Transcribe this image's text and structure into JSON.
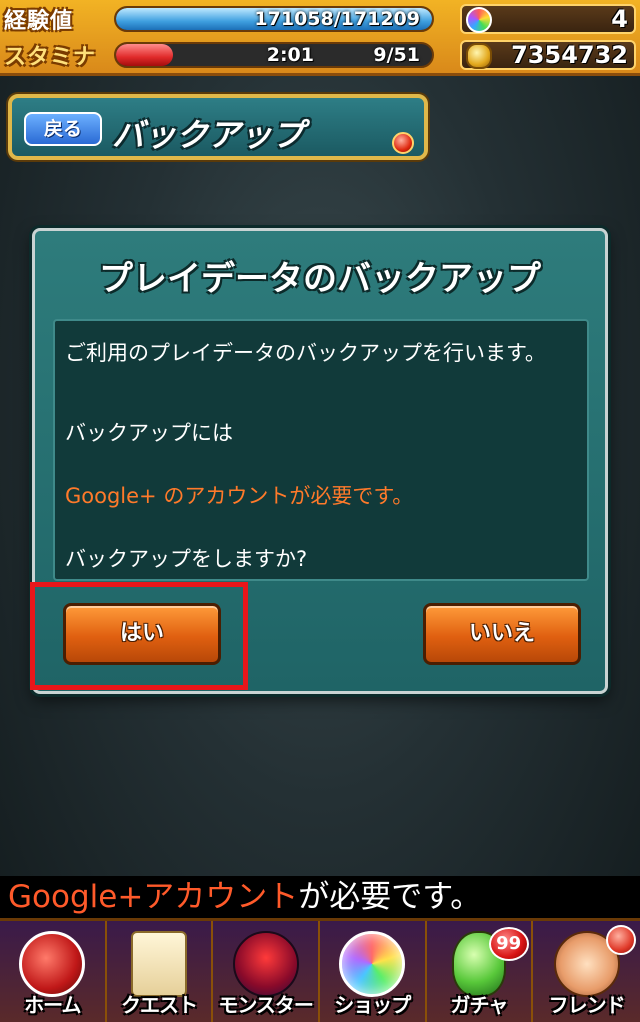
{
  "status": {
    "exp_label": "経験値",
    "exp_value": "171058/171209",
    "exp_progress": 0.999,
    "stamina_label": "スタミナ",
    "stamina_timer": "2:01",
    "stamina_value": "9/51",
    "stamina_progress": 0.18,
    "orbs": "4",
    "coins": "7354732",
    "orb_icon": "rainbow-orb-icon",
    "coin_icon": "gold-coin-icon"
  },
  "header": {
    "back_label": "戻る",
    "title": "バックアップ"
  },
  "dialog": {
    "title": "プレイデータのバックアップ",
    "lines": [
      "ご利用のプレイデータのバックアップを行います。",
      "バックアップには",
      "Google+ のアカウントが必要です。",
      "バックアップをしますか?"
    ],
    "yes_label": "はい",
    "no_label": "いいえ"
  },
  "notice": {
    "highlight": "Google+アカウント",
    "rest": "が必要です。"
  },
  "tabs": [
    {
      "label": "ホーム",
      "icon": "home-icon"
    },
    {
      "label": "クエスト",
      "icon": "quest-icon"
    },
    {
      "label": "モンスター",
      "icon": "monster-icon"
    },
    {
      "label": "ショップ",
      "icon": "shop-icon"
    },
    {
      "label": "ガチャ",
      "icon": "gacha-icon",
      "badge": "99"
    },
    {
      "label": "フレンド",
      "icon": "friend-icon"
    }
  ],
  "colors": {
    "warning_text": "#ff7a2a",
    "button_orange": "#e06010",
    "highlight_box": "#e8161a",
    "dialog_teal": "#2e7c7c"
  }
}
